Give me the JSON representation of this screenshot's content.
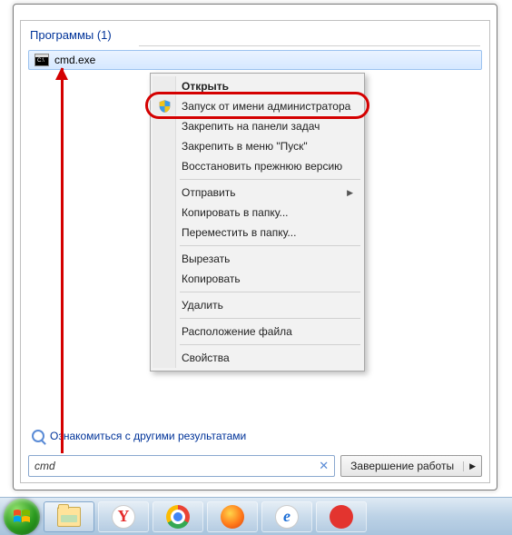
{
  "header": {
    "programs_label": "Программы (1)"
  },
  "result": {
    "filename": "cmd.exe"
  },
  "context_menu": {
    "open": "Открыть",
    "run_as_admin": "Запуск от имени администратора",
    "pin_taskbar": "Закрепить на панели задач",
    "pin_start": "Закрепить в меню \"Пуск\"",
    "restore_prev": "Восстановить прежнюю версию",
    "send_to": "Отправить",
    "copy_to_folder": "Копировать в папку...",
    "move_to_folder": "Переместить в папку...",
    "cut": "Вырезать",
    "copy": "Копировать",
    "delete": "Удалить",
    "file_location": "Расположение файла",
    "properties": "Свойства"
  },
  "more_results": "Ознакомиться с другими результатами",
  "search": {
    "value": "cmd"
  },
  "shutdown": {
    "label": "Завершение работы"
  }
}
